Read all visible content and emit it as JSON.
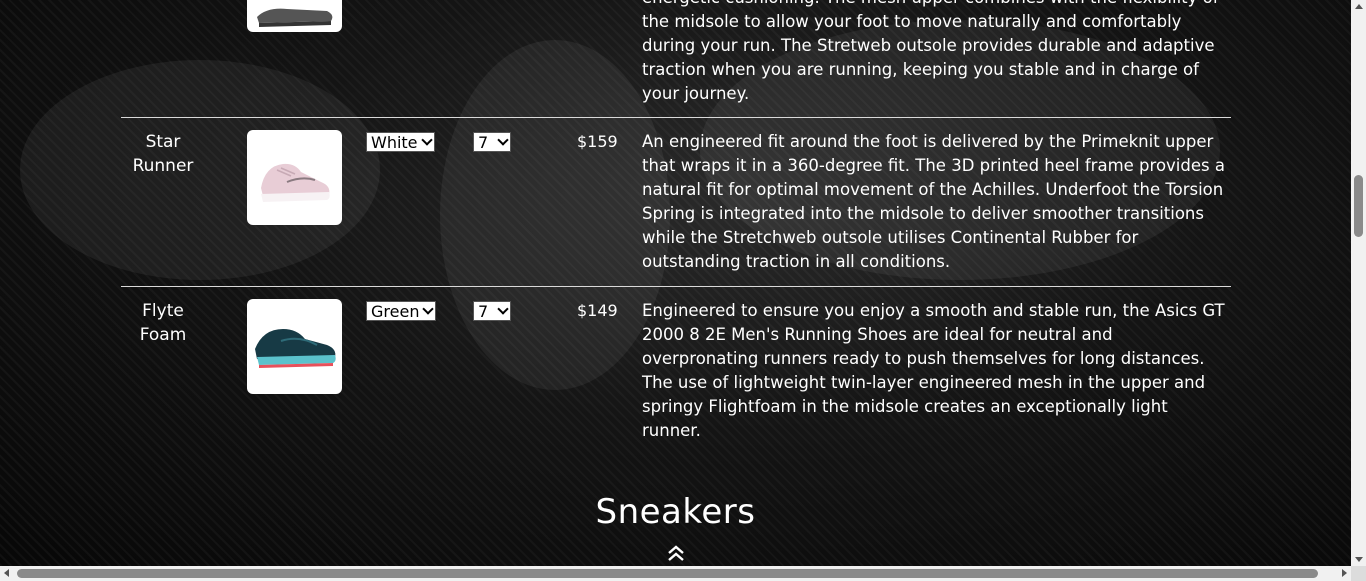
{
  "rows": [
    {
      "name_lines": [
        "",
        ""
      ],
      "description": "energetic cushioning. The mesh upper combines with the flexibility of the midsole to allow your foot to move naturally and comfortably during your run. The Stretweb outsole provides durable and adaptive traction when you are running, keeping you stable and in charge of your journey.",
      "image_icon": "gray-sneaker-image"
    },
    {
      "name_lines": [
        "Star",
        "Runner"
      ],
      "color": "White",
      "size": "7",
      "price": "$159",
      "description": "An engineered fit around the foot is delivered by the Primeknit upper that wraps it in a 360-degree fit. The 3D printed heel frame provides a natural fit for optimal movement of the Achilles. Underfoot the Torsion Spring is integrated into the midsole to deliver smoother transitions while the Stretchweb outsole utilises Continental Rubber for outstanding traction in all conditions.",
      "image_icon": "pink-sneaker-image",
      "shoe_color": "#e8cdd6"
    },
    {
      "name_lines": [
        "Flyte",
        "Foam"
      ],
      "color": "Green",
      "size": "7",
      "price": "$149",
      "description": "Engineered to ensure you enjoy a smooth and stable run, the Asics GT 2000 8 2E Men's Running Shoes are ideal for neutral and overpronating runners ready to push themselves for long distances. The use of lightweight twin-layer engineered mesh in the upper and springy Flightfoam in the midsole creates an exceptionally light runner.",
      "image_icon": "teal-sneaker-image",
      "shoe_color": "#173a45"
    }
  ],
  "section": {
    "title": "Sneakers",
    "back_to_top_icon": "double-chevron-up-icon"
  },
  "colors": {
    "background": "#0b0b0b",
    "text": "#ffffff",
    "divider": "#d9d9d9"
  }
}
